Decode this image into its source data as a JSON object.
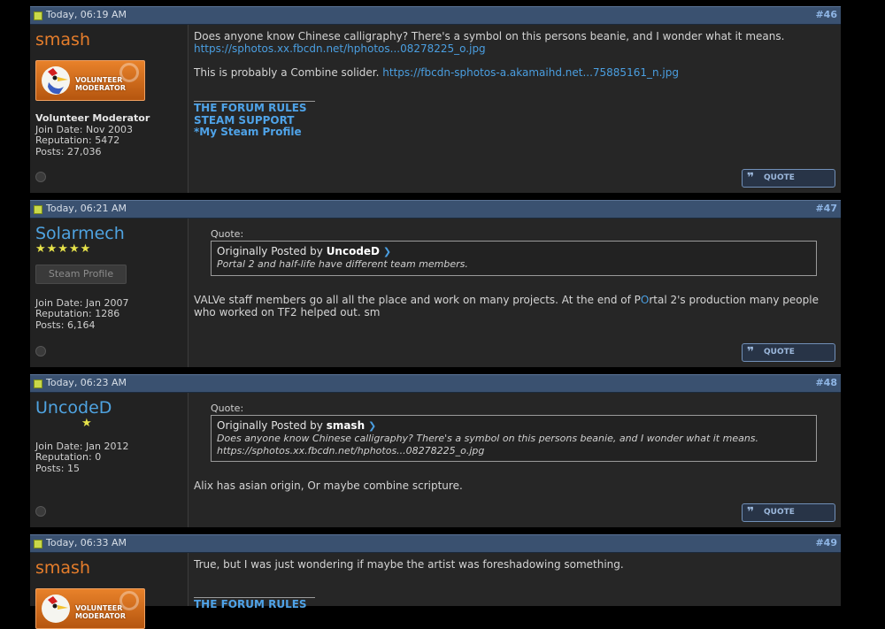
{
  "posts": [
    {
      "date": "Today, 06:19 AM",
      "number": "#46",
      "username": "smash",
      "badge_text": "VOLUNTEER MODERATOR",
      "user_title": "Volunteer Moderator",
      "join_date": "Join Date: Nov 2003",
      "reputation": "Reputation: 5472",
      "posts": "Posts: 27,036",
      "message_line1": "Does anyone know Chinese calligraphy? There's a symbol on this persons beanie, and I wonder what it means.",
      "message_link1": "https://sphotos.xx.fbcdn.net/hphotos...08278225_o.jpg",
      "message_line2": "This is probably a Combine solider.",
      "message_link2": "https://fbcdn-sphotos-a.akamaihd.net...75885161_n.jpg",
      "sig_links": [
        "THE FORUM RULES",
        "STEAM SUPPORT",
        "*My Steam Profile"
      ],
      "quote_label": "QUOTE"
    },
    {
      "date": "Today, 06:21 AM",
      "number": "#47",
      "username": "Solarmech",
      "stars": "★★★★★",
      "steam_profile": "Steam Profile",
      "join_date": "Join Date: Jan 2007",
      "reputation": "Reputation: 1286",
      "posts": "Posts: 6,164",
      "quote_header": "Quote:",
      "quote_prefix": "Originally Posted by",
      "quote_author": "UncodeD",
      "quote_text": "Portal 2 and half-life have different team members.",
      "message_a": "VALVe staff members go all all the place and work on many projects. At the end of P",
      "message_o": "O",
      "message_b": "rtal 2's production many people who worked on TF2 helped out. sm",
      "quote_label": "QUOTE"
    },
    {
      "date": "Today, 06:23 AM",
      "number": "#48",
      "username": "UncodeD",
      "stars": "★",
      "join_date": "Join Date: Jan 2012",
      "reputation": "Reputation: 0",
      "posts": "Posts: 15",
      "quote_header": "Quote:",
      "quote_prefix": "Originally Posted by",
      "quote_author": "smash",
      "quote_text": "Does anyone know Chinese calligraphy? There's a symbol on this persons beanie, and I wonder what it means.",
      "quote_link": "https://sphotos.xx.fbcdn.net/hphotos...08278225_o.jpg",
      "message": "Alix has asian origin, Or maybe combine scripture.",
      "quote_label": "QUOTE"
    },
    {
      "date": "Today, 06:33 AM",
      "number": "#49",
      "username": "smash",
      "badge_text": "VOLUNTEER MODERATOR",
      "message": "True, but I was just wondering if maybe the artist was foreshadowing something.",
      "sig_link": "THE FORUM RULES"
    }
  ],
  "colors": {
    "header_bg": "#3a5170",
    "username_orange": "#e57d2b",
    "username_blue": "#4fa3e0",
    "link": "#4a9ee0",
    "star": "#e6e24a"
  },
  "icons": {
    "status": "new-post-icon",
    "online": "offline-status-icon",
    "quote": "quote-icon",
    "arrow": "view-post-arrow-icon"
  }
}
